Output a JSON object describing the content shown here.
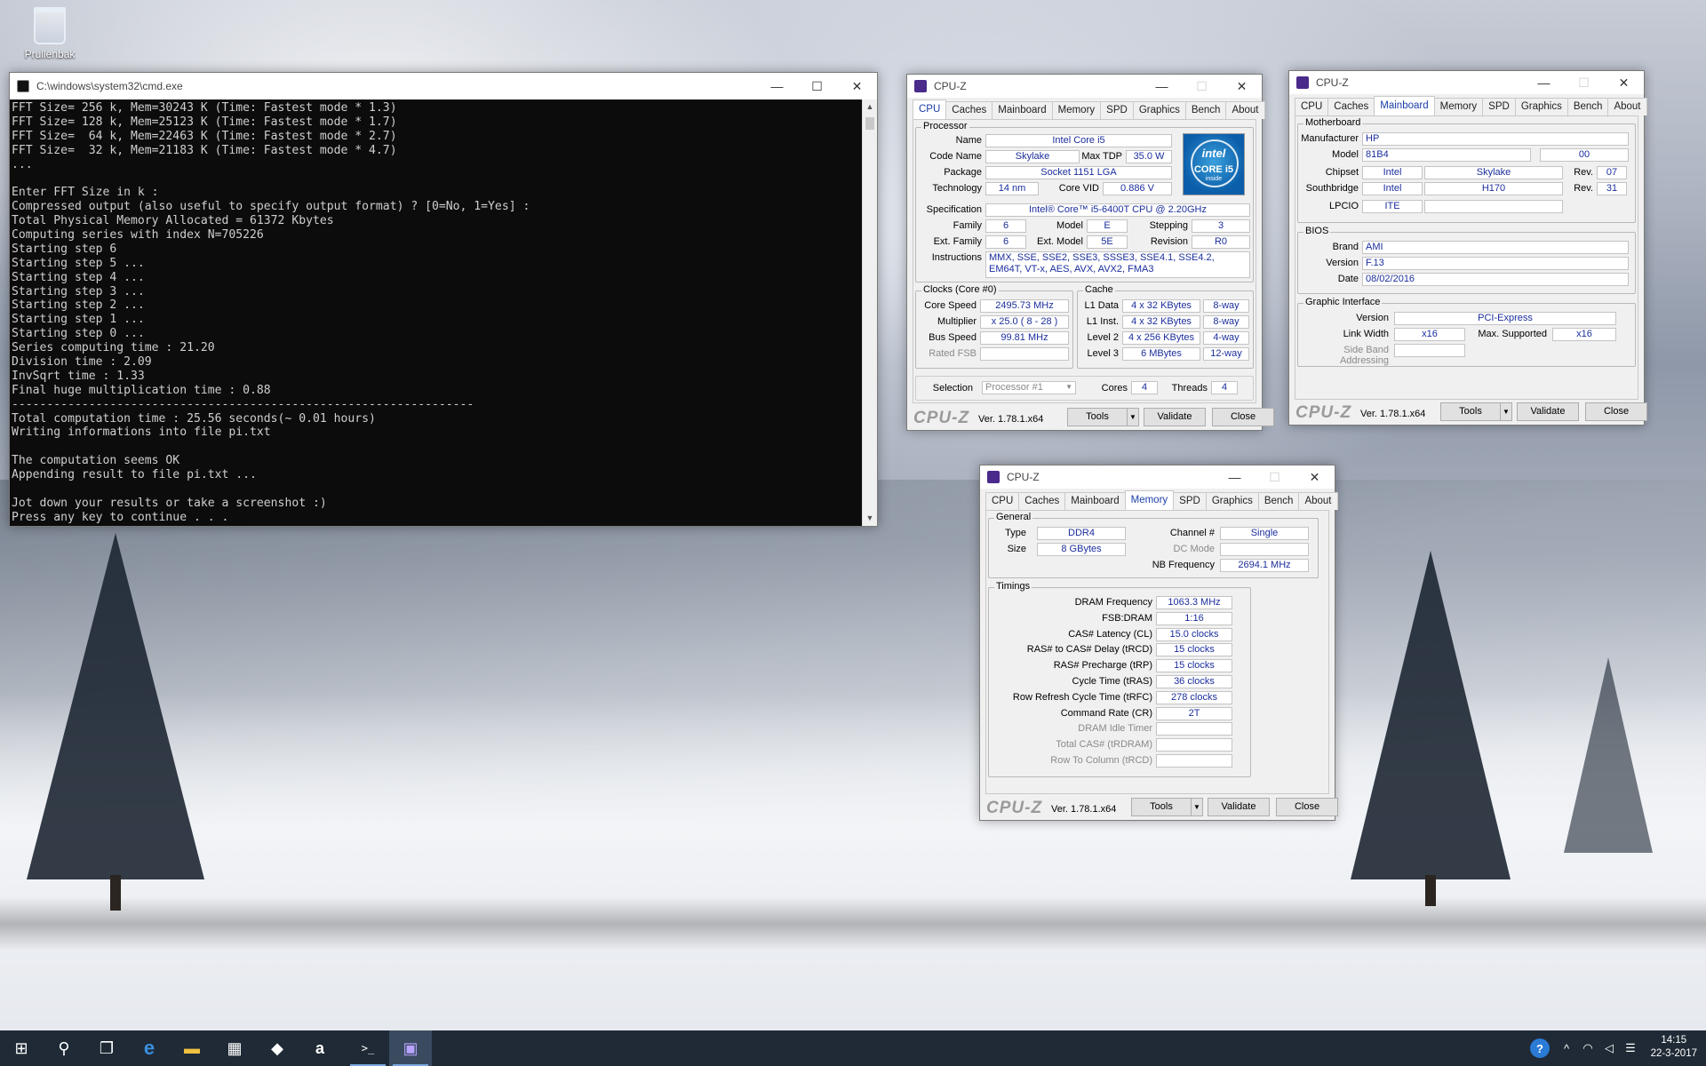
{
  "desktop": {
    "recycle_bin_label": "Prullenbak"
  },
  "cmd": {
    "title": "C:\\windows\\system32\\cmd.exe",
    "lines": [
      "FFT Size= 256 k, Mem=30243 K (Time: Fastest mode * 1.3)",
      "FFT Size= 128 k, Mem=25123 K (Time: Fastest mode * 1.7)",
      "FFT Size=  64 k, Mem=22463 K (Time: Fastest mode * 2.7)",
      "FFT Size=  32 k, Mem=21183 K (Time: Fastest mode * 4.7)",
      "...",
      "",
      "Enter FFT Size in k :",
      "Compressed output (also useful to specify output format) ? [0=No, 1=Yes] :",
      "Total Physical Memory Allocated = 61372 Kbytes",
      "Computing series with index N=705226",
      "Starting step 6",
      "Starting step 5 ...",
      "Starting step 4 ...",
      "Starting step 3 ...",
      "Starting step 2 ...",
      "Starting step 1 ...",
      "Starting step 0 ...",
      "Series computing time : 21.20",
      "Division time : 2.09",
      "InvSqrt time : 1.33",
      "Final huge multiplication time : 0.88",
      "------------------------------------------------------------------",
      "Total computation time : 25.56 seconds(~ 0.01 hours)",
      "Writing informations into file pi.txt",
      "",
      "The computation seems OK",
      "Appending result to file pi.txt ...",
      "",
      "Jot down your results or take a screenshot :)",
      "Press any key to continue . . ."
    ]
  },
  "cpuz_common": {
    "app_title": "CPU-Z",
    "logo": "CPU-Z",
    "version": "Ver. 1.78.1.x64",
    "tools": "Tools",
    "tools_arrow": "▼",
    "validate": "Validate",
    "close": "Close",
    "tabs": [
      "CPU",
      "Caches",
      "Mainboard",
      "Memory",
      "SPD",
      "Graphics",
      "Bench",
      "About"
    ]
  },
  "cpu": {
    "processor_group": "Processor",
    "name_label": "Name",
    "name": "Intel Core i5",
    "codename_label": "Code Name",
    "codename": "Skylake",
    "maxtdp_label": "Max TDP",
    "maxtdp": "35.0 W",
    "package_label": "Package",
    "package": "Socket 1151 LGA",
    "technology_label": "Technology",
    "technology": "14 nm",
    "corevid_label": "Core VID",
    "corevid": "0.886 V",
    "spec_label": "Specification",
    "spec": "Intel® Core™ i5-6400T CPU @ 2.20GHz",
    "family_label": "Family",
    "family": "6",
    "model_label": "Model",
    "model": "E",
    "stepping_label": "Stepping",
    "stepping": "3",
    "extfamily_label": "Ext. Family",
    "extfamily": "6",
    "extmodel_label": "Ext. Model",
    "extmodel": "5E",
    "revision_label": "Revision",
    "revision": "R0",
    "instr_label": "Instructions",
    "instr": "MMX, SSE, SSE2, SSE3, SSSE3, SSE4.1, SSE4.2, EM64T, VT-x, AES, AVX, AVX2, FMA3",
    "intel_logo": {
      "brand": "intel",
      "line": "CORE i5",
      "sub": "inside"
    },
    "clocks_group": "Clocks (Core #0)",
    "corespeed_label": "Core Speed",
    "corespeed": "2495.73 MHz",
    "multiplier_label": "Multiplier",
    "multiplier": "x 25.0 ( 8 - 28 )",
    "busspeed_label": "Bus Speed",
    "busspeed": "99.81 MHz",
    "ratedfsb_label": "Rated FSB",
    "ratedfsb": "",
    "cache_group": "Cache",
    "l1d_label": "L1 Data",
    "l1d": "4 x 32 KBytes",
    "l1d_way": "8-way",
    "l1i_label": "L1 Inst.",
    "l1i": "4 x 32 KBytes",
    "l1i_way": "8-way",
    "l2_label": "Level 2",
    "l2": "4 x 256 KBytes",
    "l2_way": "4-way",
    "l3_label": "Level 3",
    "l3": "6 MBytes",
    "l3_way": "12-way",
    "selection_label": "Selection",
    "selection": "Processor #1",
    "cores_label": "Cores",
    "cores": "4",
    "threads_label": "Threads",
    "threads": "4"
  },
  "mainboard": {
    "mb_group": "Motherboard",
    "manufacturer_label": "Manufacturer",
    "manufacturer": "HP",
    "model_label": "Model",
    "model": "81B4",
    "model_rev": "00",
    "chipset_label": "Chipset",
    "chipset_vendor": "Intel",
    "chipset_name": "Skylake",
    "chipset_rev_label": "Rev.",
    "chipset_rev": "07",
    "south_label": "Southbridge",
    "south_vendor": "Intel",
    "south_name": "H170",
    "south_rev_label": "Rev.",
    "south_rev": "31",
    "lpcio_label": "LPCIO",
    "lpcio": "ITE",
    "bios_group": "BIOS",
    "brand_label": "Brand",
    "brand": "AMI",
    "version_label": "Version",
    "version": "F.13",
    "date_label": "Date",
    "date": "08/02/2016",
    "gi_group": "Graphic Interface",
    "giversion_label": "Version",
    "giversion": "PCI-Express",
    "linkwidth_label": "Link Width",
    "linkwidth": "x16",
    "maxsupp_label": "Max. Supported",
    "maxsupp": "x16",
    "sideband_label": "Side Band Addressing",
    "sideband": ""
  },
  "memory": {
    "general_group": "General",
    "type_label": "Type",
    "type": "DDR4",
    "channel_label": "Channel #",
    "channel": "Single",
    "size_label": "Size",
    "size": "8 GBytes",
    "dcmode_label": "DC Mode",
    "dcmode": "",
    "nbfreq_label": "NB Frequency",
    "nbfreq": "2694.1 MHz",
    "timings_group": "Timings",
    "timings": [
      {
        "label": "DRAM Frequency",
        "value": "1063.3 MHz",
        "dis": false
      },
      {
        "label": "FSB:DRAM",
        "value": "1:16",
        "dis": false
      },
      {
        "label": "CAS# Latency (CL)",
        "value": "15.0 clocks",
        "dis": false
      },
      {
        "label": "RAS# to CAS# Delay (tRCD)",
        "value": "15 clocks",
        "dis": false
      },
      {
        "label": "RAS# Precharge (tRP)",
        "value": "15 clocks",
        "dis": false
      },
      {
        "label": "Cycle Time (tRAS)",
        "value": "36 clocks",
        "dis": false
      },
      {
        "label": "Row Refresh Cycle Time (tRFC)",
        "value": "278 clocks",
        "dis": false
      },
      {
        "label": "Command Rate (CR)",
        "value": "2T",
        "dis": false
      },
      {
        "label": "DRAM Idle Timer",
        "value": "",
        "dis": true
      },
      {
        "label": "Total CAS# (tRDRAM)",
        "value": "",
        "dis": true
      },
      {
        "label": "Row To Column (tRCD)",
        "value": "",
        "dis": true
      }
    ]
  },
  "taskbar": {
    "start": "⊞",
    "search": "⚲",
    "taskview": "❐",
    "edge": "e",
    "explorer": "▬",
    "store": "▦",
    "dropbox": "◆",
    "amazon": "a",
    "cmd": ">_",
    "cpuz": "▣",
    "help": "?",
    "chevron": "^",
    "network": "◠",
    "volume": "◁",
    "notifications": "☰",
    "time": "14:15",
    "date": "22-3-2017"
  },
  "colors": {
    "accent": "#1b3fa8",
    "value_text": "#1b2e9c",
    "console_bg": "#0c0c0c",
    "taskbar": "#1f2a36"
  }
}
